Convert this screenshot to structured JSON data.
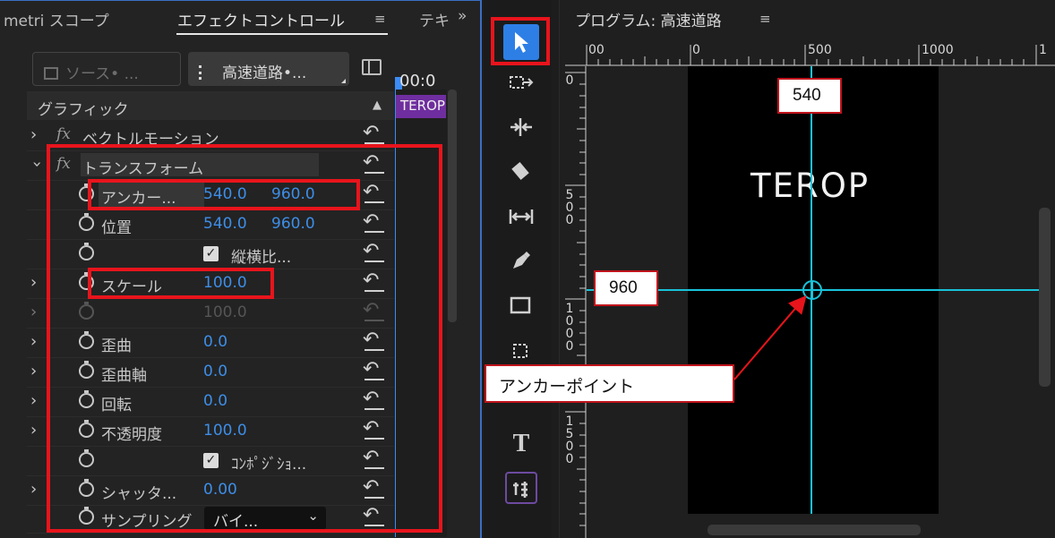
{
  "left_panel": {
    "tabs": [
      "metri スコープ",
      "エフェクトコントロール",
      "テキ"
    ],
    "menu_icon": "≡",
    "overflow_icon": "»",
    "source_button": "ソース• ...",
    "sequence_button": "高速道路•...",
    "timecode": "00:0",
    "clip_label": "TEROP",
    "section": "グラフィック",
    "effects": {
      "vector_motion": "ベクトルモーション",
      "transform": "トランスフォーム",
      "fx": "fx"
    },
    "properties": {
      "anchor": {
        "label": "アンカー...",
        "x": "540.0",
        "y": "960.0"
      },
      "position": {
        "label": "位置",
        "x": "540.0",
        "y": "960.0"
      },
      "aspect": {
        "label": "縦横比..."
      },
      "scale": {
        "label": "スケール",
        "value": "100.0"
      },
      "scale_width": {
        "value": "100.0"
      },
      "skew": {
        "label": "歪曲",
        "value": "0.0"
      },
      "skew_axis": {
        "label": "歪曲軸",
        "value": "0.0"
      },
      "rotation": {
        "label": "回転",
        "value": "0.0"
      },
      "opacity": {
        "label": "不透明度",
        "value": "100.0"
      },
      "composite": {
        "label": "ｺﾝﾎﾟｼﾞｼｮ..."
      },
      "shutter": {
        "label": "シャッタ...",
        "value": "0.00"
      },
      "sampling": {
        "label": "サンプリング",
        "value": "バイ..."
      }
    }
  },
  "tools": {
    "type_tool": "T"
  },
  "monitor": {
    "title": "プログラム: 高速道路",
    "menu_icon": "≡",
    "ruler_h": [
      "00",
      "0",
      "500",
      "1000",
      "1"
    ],
    "ruler_v": [
      [
        "0"
      ],
      [
        "5",
        "0",
        "0"
      ],
      [
        "1",
        "0",
        "0",
        "0"
      ],
      [
        "1",
        "5",
        "0",
        "0"
      ]
    ],
    "canvas_text": "TEROP"
  },
  "callouts": {
    "x_value": "540",
    "y_value": "960",
    "anchor_point": "アンカーポイント"
  },
  "colors": {
    "accent_blue": "#2d7fe6",
    "value_blue": "#3d8ee8",
    "guide_cyan": "#18c3d9",
    "highlight_red": "#e8141c",
    "clip_purple": "#6f2e9f"
  }
}
